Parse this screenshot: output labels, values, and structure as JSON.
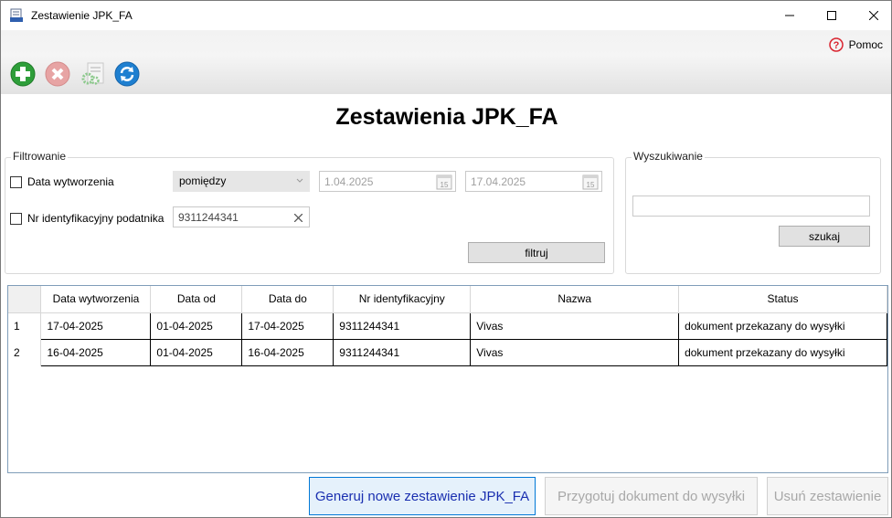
{
  "window": {
    "title": "Zestawienie JPK_FA"
  },
  "toolbar": {
    "help_label": "Pomoc",
    "tools": [
      {
        "name": "add",
        "icon": "plus-circle-icon",
        "color": "#2e9e3a"
      },
      {
        "name": "delete",
        "icon": "x-circle-icon",
        "color": "#e09090"
      },
      {
        "name": "settings",
        "icon": "gears-icon",
        "color": "#7fbf7f"
      },
      {
        "name": "refresh",
        "icon": "refresh-icon",
        "color": "#1e7fd0"
      }
    ]
  },
  "page_title": "Zestawienia JPK_FA",
  "filter": {
    "group_label": "Filtrowanie",
    "date_checkbox_label": "Data wytworzenia",
    "date_mode": "pomiędzy",
    "date_from": "1.04.2025",
    "date_to": "17.04.2025",
    "nip_checkbox_label": "Nr identyfikacyjny podatnika",
    "nip_value": "9311244341",
    "filter_button": "filtruj"
  },
  "search": {
    "group_label": "Wyszukiwanie",
    "value": "",
    "button": "szukaj"
  },
  "grid": {
    "columns": [
      "Data wytworzenia",
      "Data od",
      "Data do",
      "Nr identyfikacyjny",
      "Nazwa",
      "Status"
    ],
    "rows": [
      {
        "num": "1",
        "cells": [
          "17-04-2025",
          "01-04-2025",
          "17-04-2025",
          "9311244341",
          "Vivas",
          "dokument przekazany do wysyłki"
        ]
      },
      {
        "num": "2",
        "cells": [
          "16-04-2025",
          "01-04-2025",
          "16-04-2025",
          "9311244341",
          "Vivas",
          "dokument przekazany do wysyłki"
        ]
      }
    ]
  },
  "actions": {
    "generate": "Generuj nowe zestawienie JPK_FA",
    "prepare": "Przygotuj dokument do wysyłki",
    "remove": "Usuń zestawienie"
  }
}
